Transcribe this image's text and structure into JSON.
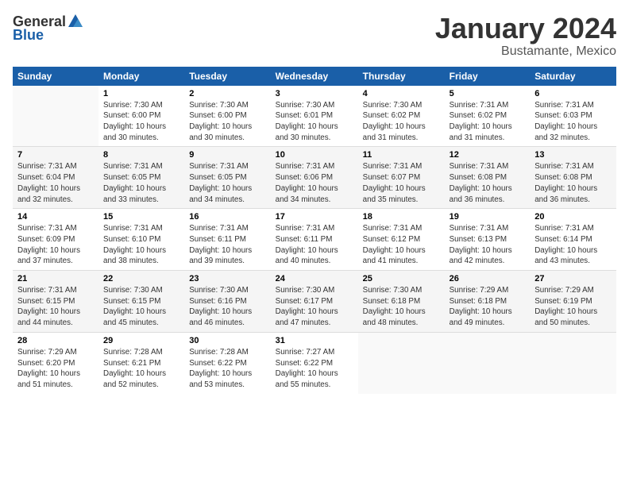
{
  "header": {
    "logo_general": "General",
    "logo_blue": "Blue",
    "month_title": "January 2024",
    "location": "Bustamante, Mexico"
  },
  "days_of_week": [
    "Sunday",
    "Monday",
    "Tuesday",
    "Wednesday",
    "Thursday",
    "Friday",
    "Saturday"
  ],
  "weeks": [
    [
      {
        "day": "",
        "info": ""
      },
      {
        "day": "1",
        "info": "Sunrise: 7:30 AM\nSunset: 6:00 PM\nDaylight: 10 hours\nand 30 minutes."
      },
      {
        "day": "2",
        "info": "Sunrise: 7:30 AM\nSunset: 6:00 PM\nDaylight: 10 hours\nand 30 minutes."
      },
      {
        "day": "3",
        "info": "Sunrise: 7:30 AM\nSunset: 6:01 PM\nDaylight: 10 hours\nand 30 minutes."
      },
      {
        "day": "4",
        "info": "Sunrise: 7:30 AM\nSunset: 6:02 PM\nDaylight: 10 hours\nand 31 minutes."
      },
      {
        "day": "5",
        "info": "Sunrise: 7:31 AM\nSunset: 6:02 PM\nDaylight: 10 hours\nand 31 minutes."
      },
      {
        "day": "6",
        "info": "Sunrise: 7:31 AM\nSunset: 6:03 PM\nDaylight: 10 hours\nand 32 minutes."
      }
    ],
    [
      {
        "day": "7",
        "info": "Sunrise: 7:31 AM\nSunset: 6:04 PM\nDaylight: 10 hours\nand 32 minutes."
      },
      {
        "day": "8",
        "info": "Sunrise: 7:31 AM\nSunset: 6:05 PM\nDaylight: 10 hours\nand 33 minutes."
      },
      {
        "day": "9",
        "info": "Sunrise: 7:31 AM\nSunset: 6:05 PM\nDaylight: 10 hours\nand 34 minutes."
      },
      {
        "day": "10",
        "info": "Sunrise: 7:31 AM\nSunset: 6:06 PM\nDaylight: 10 hours\nand 34 minutes."
      },
      {
        "day": "11",
        "info": "Sunrise: 7:31 AM\nSunset: 6:07 PM\nDaylight: 10 hours\nand 35 minutes."
      },
      {
        "day": "12",
        "info": "Sunrise: 7:31 AM\nSunset: 6:08 PM\nDaylight: 10 hours\nand 36 minutes."
      },
      {
        "day": "13",
        "info": "Sunrise: 7:31 AM\nSunset: 6:08 PM\nDaylight: 10 hours\nand 36 minutes."
      }
    ],
    [
      {
        "day": "14",
        "info": "Sunrise: 7:31 AM\nSunset: 6:09 PM\nDaylight: 10 hours\nand 37 minutes."
      },
      {
        "day": "15",
        "info": "Sunrise: 7:31 AM\nSunset: 6:10 PM\nDaylight: 10 hours\nand 38 minutes."
      },
      {
        "day": "16",
        "info": "Sunrise: 7:31 AM\nSunset: 6:11 PM\nDaylight: 10 hours\nand 39 minutes."
      },
      {
        "day": "17",
        "info": "Sunrise: 7:31 AM\nSunset: 6:11 PM\nDaylight: 10 hours\nand 40 minutes."
      },
      {
        "day": "18",
        "info": "Sunrise: 7:31 AM\nSunset: 6:12 PM\nDaylight: 10 hours\nand 41 minutes."
      },
      {
        "day": "19",
        "info": "Sunrise: 7:31 AM\nSunset: 6:13 PM\nDaylight: 10 hours\nand 42 minutes."
      },
      {
        "day": "20",
        "info": "Sunrise: 7:31 AM\nSunset: 6:14 PM\nDaylight: 10 hours\nand 43 minutes."
      }
    ],
    [
      {
        "day": "21",
        "info": "Sunrise: 7:31 AM\nSunset: 6:15 PM\nDaylight: 10 hours\nand 44 minutes."
      },
      {
        "day": "22",
        "info": "Sunrise: 7:30 AM\nSunset: 6:15 PM\nDaylight: 10 hours\nand 45 minutes."
      },
      {
        "day": "23",
        "info": "Sunrise: 7:30 AM\nSunset: 6:16 PM\nDaylight: 10 hours\nand 46 minutes."
      },
      {
        "day": "24",
        "info": "Sunrise: 7:30 AM\nSunset: 6:17 PM\nDaylight: 10 hours\nand 47 minutes."
      },
      {
        "day": "25",
        "info": "Sunrise: 7:30 AM\nSunset: 6:18 PM\nDaylight: 10 hours\nand 48 minutes."
      },
      {
        "day": "26",
        "info": "Sunrise: 7:29 AM\nSunset: 6:18 PM\nDaylight: 10 hours\nand 49 minutes."
      },
      {
        "day": "27",
        "info": "Sunrise: 7:29 AM\nSunset: 6:19 PM\nDaylight: 10 hours\nand 50 minutes."
      }
    ],
    [
      {
        "day": "28",
        "info": "Sunrise: 7:29 AM\nSunset: 6:20 PM\nDaylight: 10 hours\nand 51 minutes."
      },
      {
        "day": "29",
        "info": "Sunrise: 7:28 AM\nSunset: 6:21 PM\nDaylight: 10 hours\nand 52 minutes."
      },
      {
        "day": "30",
        "info": "Sunrise: 7:28 AM\nSunset: 6:22 PM\nDaylight: 10 hours\nand 53 minutes."
      },
      {
        "day": "31",
        "info": "Sunrise: 7:27 AM\nSunset: 6:22 PM\nDaylight: 10 hours\nand 55 minutes."
      },
      {
        "day": "",
        "info": ""
      },
      {
        "day": "",
        "info": ""
      },
      {
        "day": "",
        "info": ""
      }
    ]
  ]
}
